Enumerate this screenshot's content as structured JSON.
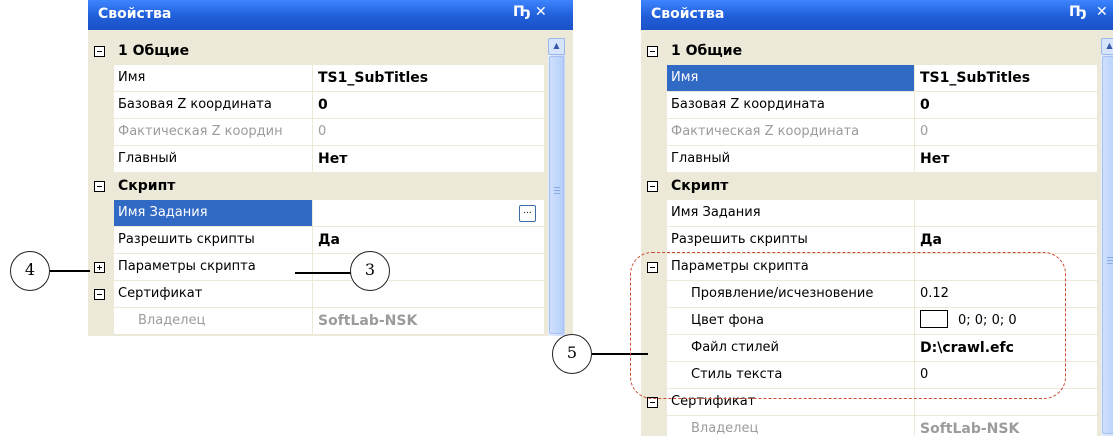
{
  "panel_a": {
    "title": "Свойства",
    "pin_glyph": "Ҧ",
    "close_glyph": "✕",
    "rows": [
      {
        "name": "1 Общие",
        "value": "",
        "cat": true
      },
      {
        "name": "Имя",
        "value": "TS1_SubTitles",
        "bold": true
      },
      {
        "name": "Базовая Z координата",
        "value": "0",
        "bold": true
      },
      {
        "name": "Фактическая Z координ",
        "value": "0",
        "gray": true
      },
      {
        "name": "Главный",
        "value": "Нет",
        "bold": true
      },
      {
        "name": "Скрипт",
        "value": "",
        "cat": true
      },
      {
        "name": "Имя Задания",
        "value": "",
        "sel": true,
        "ellipsis": "..."
      },
      {
        "name": "Разрешить скрипты",
        "value": "Да",
        "bold": true
      },
      {
        "name": "Параметры скрипта",
        "value": "",
        "expander": "plus"
      },
      {
        "name": "Сертификат",
        "value": "",
        "expander": "minus"
      },
      {
        "name": "Владелец",
        "value": "SoftLab-NSK",
        "gray": true,
        "bold": true,
        "sub": true
      }
    ]
  },
  "panel_b": {
    "title": "Свойства",
    "pin_glyph": "Ҧ",
    "close_glyph": "✕",
    "rows": [
      {
        "name": "1 Общие",
        "value": "",
        "cat": true
      },
      {
        "name": "Имя",
        "value": "TS1_SubTitles",
        "bold": true,
        "sel": true
      },
      {
        "name": "Базовая Z координата",
        "value": "0",
        "bold": true
      },
      {
        "name": "Фактическая Z координата",
        "value": "0",
        "gray": true
      },
      {
        "name": "Главный",
        "value": "Нет",
        "bold": true
      },
      {
        "name": "Скрипт",
        "value": "",
        "cat": true
      },
      {
        "name": "Имя Задания",
        "value": ""
      },
      {
        "name": "Разрешить скрипты",
        "value": "Да",
        "bold": true
      },
      {
        "name": "Параметры скрипта",
        "value": "",
        "expander": "minus"
      },
      {
        "name": "Проявление/исчезновение",
        "value": "0.12",
        "sub": true
      },
      {
        "name": "Цвет фона",
        "value": "0; 0; 0; 0",
        "sub": true,
        "swatch": true
      },
      {
        "name": "Файл стилей",
        "value": "D:\\crawl.efc",
        "bold": true,
        "sub": true
      },
      {
        "name": "Стиль текста",
        "value": "0",
        "sub": true
      },
      {
        "name": "Сертификат",
        "value": "",
        "expander": "minus"
      },
      {
        "name": "Владелец",
        "value": "SoftLab-NSK",
        "gray": true,
        "bold": true,
        "sub": true
      }
    ]
  },
  "callouts": {
    "c3": "3",
    "c4": "4",
    "c5": "5"
  },
  "colors": {
    "title_blue": "#1f5ed8",
    "selection": "#316ac5",
    "dash": "#c84a2e",
    "panel_bg": "#ece9d8"
  }
}
